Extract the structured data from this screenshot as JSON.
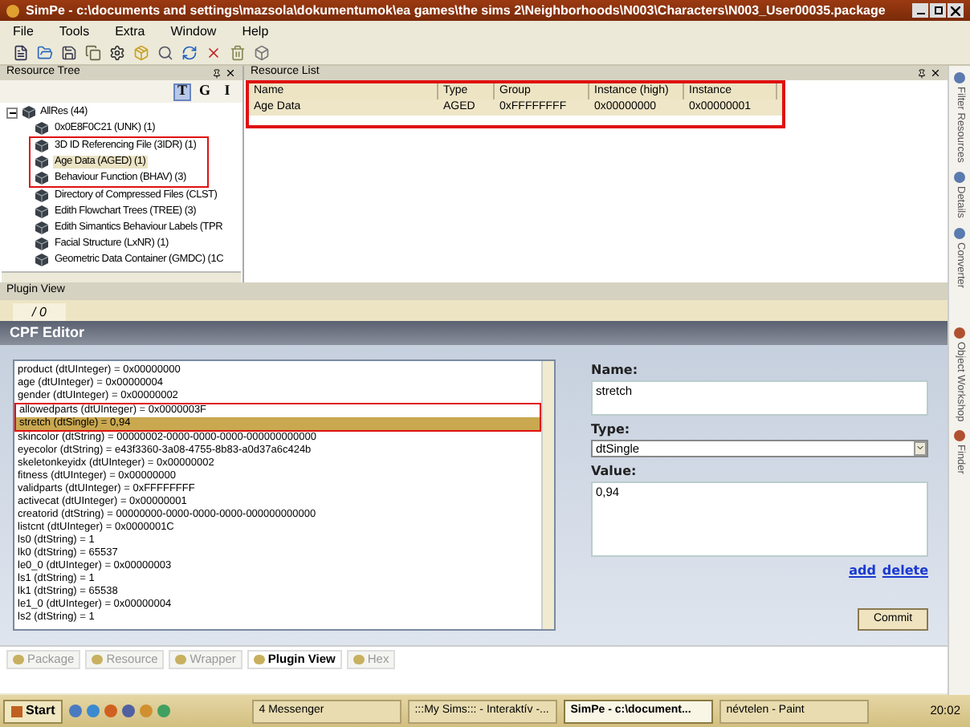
{
  "window": {
    "title": "SimPe - c:\\documents and settings\\mazsola\\dokumentumok\\ea games\\the sims 2\\Neighborhoods\\N003\\Characters\\N003_User00035.package"
  },
  "menu": [
    "File",
    "Tools",
    "Extra",
    "Window",
    "Help"
  ],
  "resource_tree": {
    "title": "Resource Tree",
    "view_buttons": [
      {
        "label": "T",
        "selected": true
      },
      {
        "label": "G",
        "selected": false
      },
      {
        "label": "I",
        "selected": false
      }
    ],
    "root": {
      "label": "AllRes (44)",
      "expanded": true,
      "children": [
        {
          "label": "0x0E8F0C21 (UNK) (1)",
          "selected": false,
          "highlighted": false
        },
        {
          "label": "3D ID Referencing File (3IDR) (1)",
          "selected": false,
          "highlighted": true
        },
        {
          "label": "Age Data (AGED) (1)",
          "selected": true,
          "highlighted": true
        },
        {
          "label": "Behaviour Function (BHAV) (3)",
          "selected": false,
          "highlighted": true
        },
        {
          "label": "Directory of Compressed Files (CLST)",
          "selected": false,
          "highlighted": false
        },
        {
          "label": "Edith Flowchart Trees (TREE) (3)",
          "selected": false,
          "highlighted": false
        },
        {
          "label": "Edith Simantics Behaviour Labels (TPR",
          "selected": false,
          "highlighted": false
        },
        {
          "label": "Facial Structure (LxNR) (1)",
          "selected": false,
          "highlighted": false
        },
        {
          "label": "Geometric Data Container (GMDC) (1C",
          "selected": false,
          "highlighted": false
        }
      ]
    }
  },
  "resource_list": {
    "title": "Resource List",
    "highlighted": true,
    "columns": [
      "Name",
      "Type",
      "Group",
      "Instance (high)",
      "Instance"
    ],
    "rows": [
      {
        "cells": [
          "Age Data",
          "AGED",
          "0xFFFFFFFF",
          "0x00000000",
          "0x00000001"
        ],
        "selected": true
      }
    ]
  },
  "side_tabs": [
    "Filter Resources",
    "Details",
    "Converter",
    "Object Workshop",
    "Finder"
  ],
  "plugin_view": {
    "title": "Plugin View",
    "tab": "/ 0",
    "editor_title": "CPF Editor",
    "entries": [
      {
        "text": "product (dtUInteger) = 0x00000000",
        "selected": false,
        "highlighted": false
      },
      {
        "text": "age (dtUInteger) = 0x00000004",
        "selected": false,
        "highlighted": false
      },
      {
        "text": "gender (dtUInteger) = 0x00000002",
        "selected": false,
        "highlighted": false
      },
      {
        "text": "allowedparts (dtUInteger) = 0x0000003F",
        "selected": false,
        "highlighted": true
      },
      {
        "text": "stretch (dtSingle) = 0,94",
        "selected": true,
        "highlighted": true
      },
      {
        "text": "skincolor (dtString) = 00000002-0000-0000-0000-000000000000",
        "selected": false,
        "highlighted": false
      },
      {
        "text": "eyecolor (dtString) = e43f3360-3a08-4755-8b83-a0d37a6c424b",
        "selected": false,
        "highlighted": false
      },
      {
        "text": "skeletonkeyidx (dtUInteger) = 0x00000002",
        "selected": false,
        "highlighted": false
      },
      {
        "text": "fitness (dtUInteger) = 0x00000000",
        "selected": false,
        "highlighted": false
      },
      {
        "text": "validparts (dtUInteger) = 0xFFFFFFFF",
        "selected": false,
        "highlighted": false
      },
      {
        "text": "activecat (dtUInteger) = 0x00000001",
        "selected": false,
        "highlighted": false
      },
      {
        "text": "creatorid (dtString) = 00000000-0000-0000-0000-000000000000",
        "selected": false,
        "highlighted": false
      },
      {
        "text": "listcnt (dtUInteger) = 0x0000001C",
        "selected": false,
        "highlighted": false
      },
      {
        "text": "ls0 (dtString) = 1",
        "selected": false,
        "highlighted": false
      },
      {
        "text": "lk0 (dtString) = 65537",
        "selected": false,
        "highlighted": false
      },
      {
        "text": "le0_0 (dtUInteger) = 0x00000003",
        "selected": false,
        "highlighted": false
      },
      {
        "text": "ls1 (dtString) = 1",
        "selected": false,
        "highlighted": false
      },
      {
        "text": "lk1 (dtString) = 65538",
        "selected": false,
        "highlighted": false
      },
      {
        "text": "le1_0 (dtUInteger) = 0x00000004",
        "selected": false,
        "highlighted": false
      },
      {
        "text": "ls2 (dtString) = 1",
        "selected": false,
        "highlighted": false
      }
    ],
    "name_label": "Name:",
    "name_value": "stretch",
    "type_label": "Type:",
    "type_value": "dtSingle",
    "value_label": "Value:",
    "value_value": "0,94",
    "links": [
      "add",
      "delete"
    ],
    "commit": "Commit"
  },
  "bottom_tabs": [
    {
      "label": "Package",
      "selected": false
    },
    {
      "label": "Resource",
      "selected": false
    },
    {
      "label": "Wrapper",
      "selected": false
    },
    {
      "label": "Plugin View",
      "selected": true
    },
    {
      "label": "Hex",
      "selected": false
    }
  ],
  "taskbar": {
    "start": "Start",
    "tasks": [
      {
        "label": "4 Messenger",
        "selected": false
      },
      {
        "label": ":::My Sims::: - Interaktív -...",
        "selected": false
      },
      {
        "label": "SimPe - c:\\document...",
        "selected": true
      },
      {
        "label": "névtelen - Paint",
        "selected": false
      }
    ],
    "clock": "20:02"
  }
}
